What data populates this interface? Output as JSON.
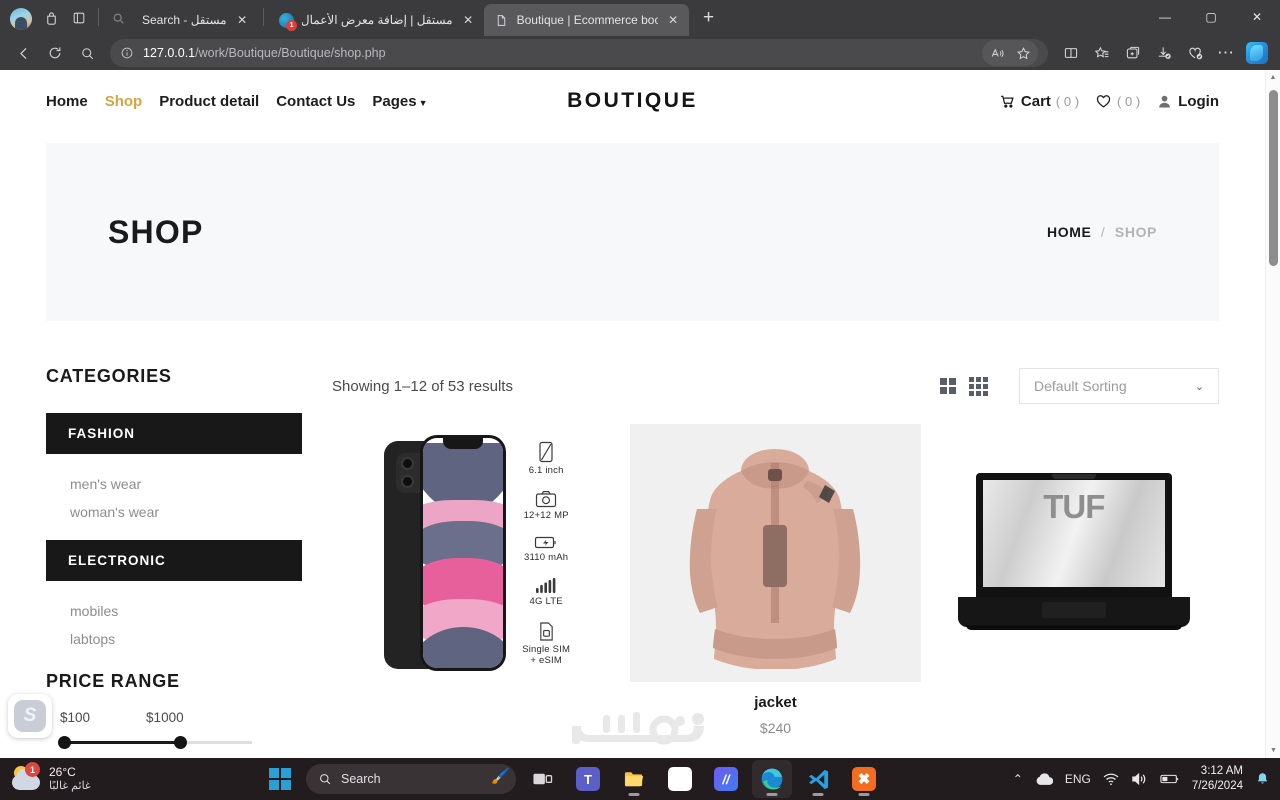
{
  "browser": {
    "tabs": [
      {
        "title": "مستقل - Search",
        "rtl": true,
        "favicon": "none",
        "active": false
      },
      {
        "title": "مستقل | إضافة معرض الأعمال (1)",
        "rtl": true,
        "favicon": "mostaql",
        "active": false
      },
      {
        "title": "Boutique | Ecommerce bootstrap",
        "rtl": false,
        "favicon": "page",
        "active": true
      }
    ],
    "new_tab_label": "+",
    "close_label": "✕",
    "url_host": "127.0.0.1",
    "url_path": "/work/Boutique/Boutique/shop.php",
    "toolbar_icons": [
      "back-icon",
      "refresh-icon",
      "search-icon",
      "info-icon",
      "read-aloud-icon",
      "favorite-star-icon",
      "split-screen-icon",
      "collections-star-icon",
      "add-tab-group-icon",
      "downloads-icon",
      "browser-essentials-icon",
      "more-options-icon",
      "copilot-icon"
    ],
    "window_controls": {
      "minimize": "—",
      "maximize": "▢",
      "close": "✕"
    }
  },
  "site": {
    "nav": [
      {
        "label": "Home",
        "active": false
      },
      {
        "label": "Shop",
        "active": true
      },
      {
        "label": "Product detail",
        "active": false
      },
      {
        "label": "Contact Us",
        "active": false
      },
      {
        "label": "Pages",
        "active": false,
        "has_caret": true
      }
    ],
    "brand": "BOUTIQUE",
    "header_right": {
      "cart_label": "Cart",
      "cart_count": "( 0 )",
      "wishlist_count": "( 0 )",
      "login_label": "Login"
    },
    "hero": {
      "title": "SHOP",
      "breadcrumb_home": "HOME",
      "breadcrumb_sep": "/",
      "breadcrumb_current": "SHOP"
    },
    "sidebar": {
      "categories_title": "CATEGORIES",
      "groups": [
        {
          "heading": "FASHION",
          "links": [
            "men's wear",
            "woman's wear"
          ]
        },
        {
          "heading": "ELECTRONIC",
          "links": [
            "mobiles",
            "labtops"
          ]
        }
      ],
      "price_title": "PRICE RANGE",
      "price_min": "$100",
      "price_max": "$1000"
    },
    "results": {
      "showing_text": "Showing 1–12 of 53 results",
      "sorting_value": "Default Sorting",
      "sorting_chevron": "⌄",
      "view_grid_2": "grid-2-icon",
      "view_grid_3": "grid-3-icon"
    },
    "products": [
      {
        "name": "",
        "price": "",
        "kind": "iphone",
        "specs": [
          {
            "icon": "phone-icon",
            "label": "6.1 inch"
          },
          {
            "icon": "camera-icon",
            "label": "12+12 MP"
          },
          {
            "icon": "battery-icon",
            "label": "3110 mAh"
          },
          {
            "icon": "signal-icon",
            "label": "4G LTE"
          },
          {
            "icon": "sim-icon",
            "label": "Single SIM\n+ eSIM"
          }
        ]
      },
      {
        "name": "jacket",
        "price": "$240",
        "kind": "jacket"
      },
      {
        "name": "",
        "price": "",
        "kind": "laptop",
        "screen_text": "TUF"
      }
    ],
    "watermark": "مستقل"
  },
  "taskbar": {
    "weather_temp": "26°C",
    "weather_desc": "غائم غالبًا",
    "weather_badge": "1",
    "search_placeholder": "Search",
    "apps": [
      "start-button",
      "search-box",
      "task-view-icon",
      "teams-icon",
      "file-explorer-icon",
      "microsoft-store-icon",
      "filmora-icon",
      "microsoft-edge-icon",
      "vs-code-icon",
      "xampp-icon"
    ],
    "tray": {
      "overflow": "⌃",
      "onedrive": "cloud-icon",
      "language": "ENG",
      "wifi": "wifi-icon",
      "volume": "volume-icon",
      "battery": "battery-icon",
      "time": "3:12 AM",
      "date": "7/26/2024",
      "notification": "bell-icon"
    }
  },
  "colors": {
    "accent_gold": "#d9a441",
    "dark": "#181818",
    "muted": "#8d8d8d",
    "chrome_bg": "#3b3b3d",
    "taskbar_bg": "#221c1e"
  }
}
